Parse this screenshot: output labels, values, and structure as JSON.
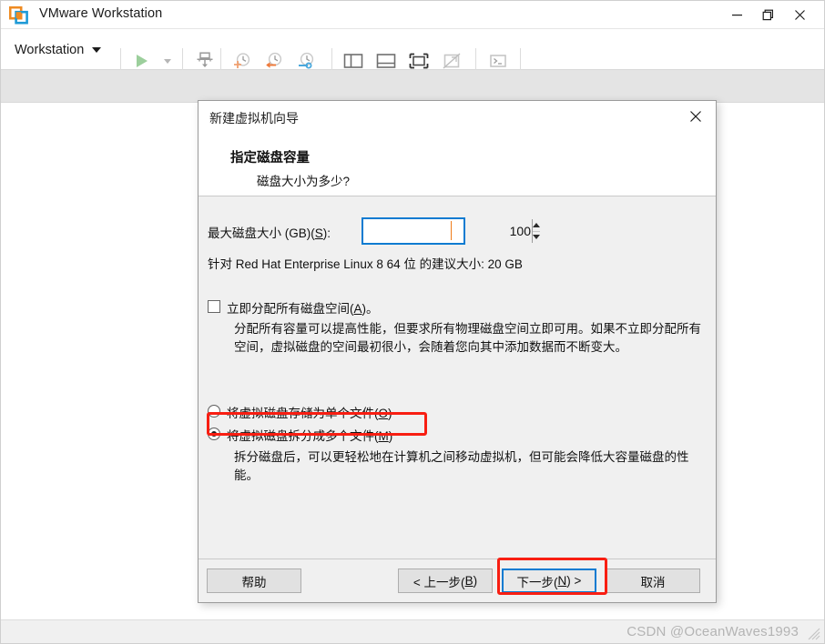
{
  "app": {
    "title": "VMware Workstation",
    "logo_icon": "vmware-logo-icon",
    "window_controls": {
      "minimize": "minimize-icon",
      "maximize": "restore-icon",
      "close": "close-icon"
    }
  },
  "toolbar": {
    "menu_label": "Workstation",
    "menu_caret_icon": "chevron-down-icon",
    "items": [
      {
        "name": "power-on-icon",
        "label": ""
      },
      {
        "name": "power-dropdown-caret-icon",
        "label": ""
      },
      {
        "name": "manage-vm-icon",
        "label": ""
      },
      {
        "name": "take-snapshot-icon",
        "label": ""
      },
      {
        "name": "revert-snapshot-icon",
        "label": ""
      },
      {
        "name": "snapshot-manager-icon",
        "label": ""
      },
      {
        "name": "show-library-icon",
        "label": ""
      },
      {
        "name": "show-thumbnail-bar-icon",
        "label": ""
      },
      {
        "name": "full-screen-icon",
        "label": ""
      },
      {
        "name": "unity-mode-icon",
        "label": ""
      },
      {
        "name": "console-icon",
        "label": ""
      }
    ]
  },
  "wizard": {
    "title": "新建虚拟机向导",
    "close_icon": "close-icon",
    "heading": "指定磁盘容量",
    "subheading": "磁盘大小为多少?",
    "disk_size": {
      "label_pre": "最大磁盘大小 (GB)(",
      "label_mnemonic": "S",
      "label_post": "):",
      "value": "100",
      "spinner_up_icon": "spinner-up-icon",
      "spinner_down_icon": "spinner-down-icon"
    },
    "recommended": "针对 Red Hat Enterprise Linux 8 64 位 的建议大小: 20 GB",
    "allocate": {
      "checked": false,
      "label_pre": "立即分配所有磁盘空间(",
      "label_mnemonic": "A",
      "label_post": ")。",
      "description": "分配所有容量可以提高性能，但要求所有物理磁盘空间立即可用。如果不立即分配所有空间，虚拟磁盘的空间最初很小，会随着您向其中添加数据而不断变大。"
    },
    "storage_options": [
      {
        "id": "single-file",
        "checked": false,
        "label_pre": "将虚拟磁盘存储为单个文件(",
        "label_mnemonic": "O",
        "label_post": ")"
      },
      {
        "id": "split-files",
        "checked": true,
        "label_pre": "将虚拟磁盘拆分成多个文件(",
        "label_mnemonic": "M",
        "label_post": ")"
      }
    ],
    "split_description": "拆分磁盘后，可以更轻松地在计算机之间移动虚拟机，但可能会降低大容量磁盘的性能。",
    "buttons": {
      "help": "帮助",
      "back_pre": "< 上一步(",
      "back_mnemonic": "B",
      "back_post": ")",
      "next_pre": "下一步(",
      "next_mnemonic": "N",
      "next_post": ") >",
      "cancel": "取消"
    }
  },
  "annotations": {
    "highlight_color": "#f81e12",
    "focus_color": "#0a7bd1",
    "boxes": [
      "split-files-radio",
      "next-button"
    ]
  },
  "statusbar": {
    "watermark": "CSDN @OceanWaves1993",
    "grip_icon": "resize-grip-icon"
  }
}
